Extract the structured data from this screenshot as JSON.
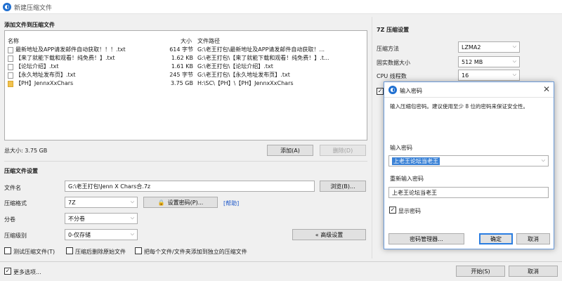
{
  "window": {
    "title": "新建压缩文件",
    "icon": "app-icon"
  },
  "files_section": {
    "title": "添加文件到压缩文件",
    "columns": [
      "名称",
      "大小",
      "文件路径"
    ],
    "rows": [
      {
        "name": "最新地址及APP请发邮件自动获取！！！.txt",
        "size": "614 字节",
        "path": "G:\\老王打包\\最新地址及APP请发邮件自动获取！..."
      },
      {
        "name": "【来了就能下载和观看！纯免费！】.txt",
        "size": "1.62 KB",
        "path": "G:\\老王打包\\【来了就能下载和观看！纯免费！】.t..."
      },
      {
        "name": "【论坛介绍】.txt",
        "size": "1.61 KB",
        "path": "G:\\老王打包\\【论坛介绍】.txt"
      },
      {
        "name": "【永久地址发布页】.txt",
        "size": "245 字节",
        "path": "G:\\老王打包\\【永久地址发布页】.txt"
      },
      {
        "name": "【PH】JennxXxChars",
        "size": "3.75 GB",
        "path": "H:\\SC\\【PH】\\【PH】JennxXxChars"
      }
    ],
    "total": "总大小: 3.75 GB",
    "add_button": "添加(A)",
    "delete_button": "删除(D)"
  },
  "settings": {
    "title": "压缩文件设置",
    "filename_label": "文件名",
    "filename_value": "G:\\老王打包\\Jenn X Chars合.7z",
    "browse_button": "浏览(B)...",
    "format_label": "压缩格式",
    "format_value": "7Z",
    "set_password_button": "设置密码(P)...",
    "help_link": "[帮助]",
    "split_label": "分卷",
    "split_value": "不分卷",
    "level_label": "压缩级别",
    "level_value": "0-仅存储",
    "advanced_button": "« 高级设置",
    "test_label": "测试压缩文件(T)",
    "delete_after_label": "压缩后删除原始文件",
    "separate_label": "把每个文件/文件夹添加到独立的压缩文件"
  },
  "footer": {
    "more_options": "更多选项...",
    "start_button": "开始(S)",
    "cancel_button": "取消"
  },
  "sevenz": {
    "title": "7Z 压缩设置",
    "method_label": "压缩方法",
    "method_value": "LZMA2",
    "dict_label": "固实数据大小",
    "dict_value": "512 MB",
    "threads_label": "CPU 线程数",
    "threads_value": "16"
  },
  "password_dialog": {
    "title": "输入密码",
    "description": "输入压缩包密码。建议使用至少 8 位的密码来保证安全性。",
    "enter_label": "输入密码",
    "enter_value": "上老王论坛当老王",
    "reenter_label": "重新输入密码",
    "reenter_value": "上老王论坛当老王",
    "show_password": "显示密码",
    "manager_button": "密码管理器...",
    "ok_button": "确定",
    "cancel_button": "取消"
  }
}
